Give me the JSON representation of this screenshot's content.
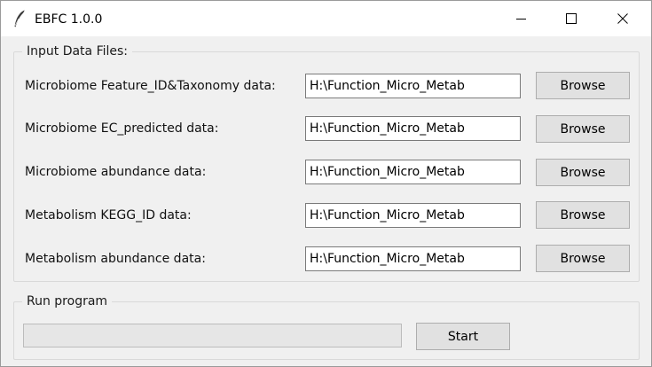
{
  "window": {
    "title": "EBFC 1.0.0",
    "icon": "feather-icon",
    "controls": [
      "minimize-icon",
      "maximize-icon",
      "close-icon"
    ]
  },
  "input_files": {
    "legend": "Input Data Files:",
    "rows": [
      {
        "label": "Microbiome Feature_ID&Taxonomy data:",
        "value": "H:\\Function_Micro_Metab",
        "button": "Browse"
      },
      {
        "label": "Microbiome EC_predicted data:",
        "value": "H:\\Function_Micro_Metab",
        "button": "Browse"
      },
      {
        "label": "Microbiome abundance data:",
        "value": "H:\\Function_Micro_Metab",
        "button": "Browse"
      },
      {
        "label": "Metabolism KEGG_ID data:",
        "value": "H:\\Function_Micro_Metab",
        "button": "Browse"
      },
      {
        "label": "Metabolism abundance data:",
        "value": "H:\\Function_Micro_Metab",
        "button": "Browse"
      }
    ]
  },
  "run": {
    "legend": "Run program",
    "progress": 0,
    "start_label": "Start"
  }
}
